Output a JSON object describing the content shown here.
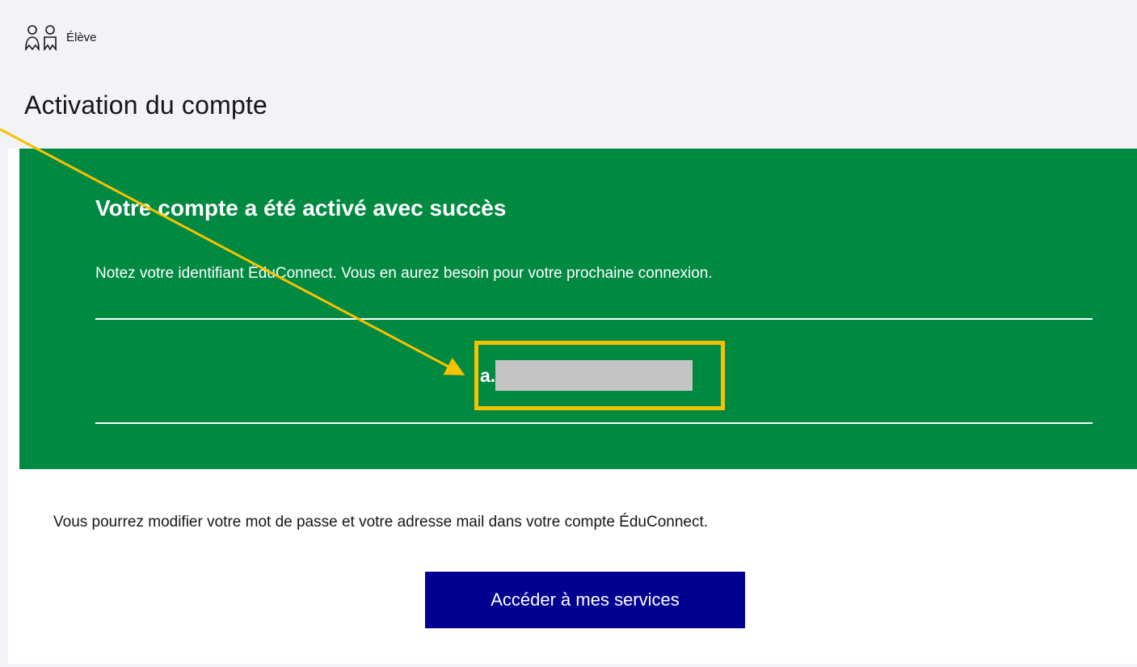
{
  "header": {
    "role_label": "Élève",
    "role_icon": "users-icon"
  },
  "page": {
    "title": "Activation du compte"
  },
  "success": {
    "title": "Votre compte a été activé avec succès",
    "message": "Notez votre identifiant ÉduConnect. Vous en aurez besoin pour votre prochaine connexion.",
    "identifier_prefix": "a."
  },
  "info": {
    "text": "Vous pourrez modifier votre mot de passe et votre adresse mail dans votre compte ÉduConnect."
  },
  "actions": {
    "access_button_label": "Accéder à mes services"
  },
  "colors": {
    "success_green": "#008941",
    "primary_blue": "#000091",
    "annotation_yellow": "#f8c200",
    "background": "#f2f2f7"
  }
}
